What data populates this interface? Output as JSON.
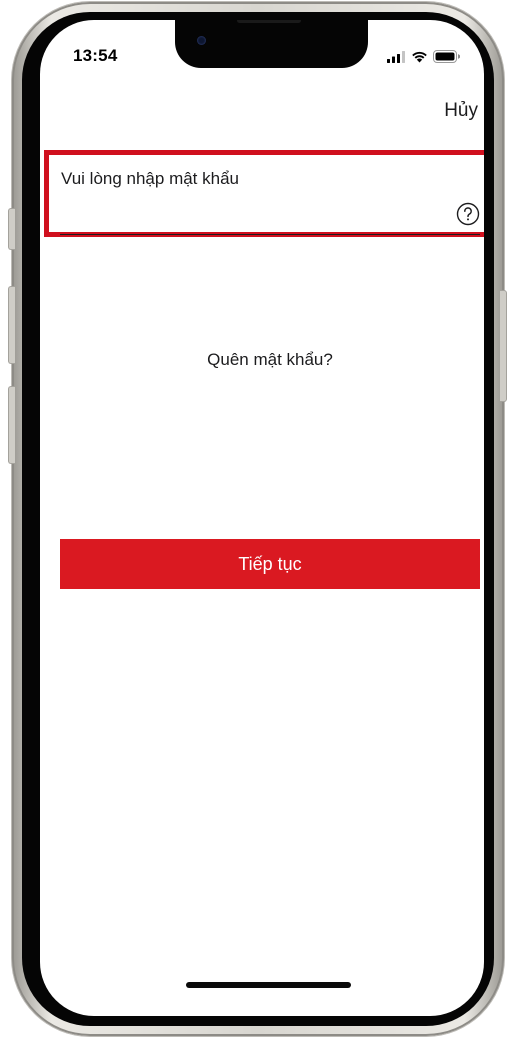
{
  "status_bar": {
    "time": "13:54",
    "icons": [
      "cellular-signal-icon",
      "wifi-icon",
      "battery-icon"
    ]
  },
  "header": {
    "cancel_label": "Hủy"
  },
  "password_field": {
    "label": "Vui lòng nhập mật khẩu",
    "value": "",
    "help_icon": "question-circle-icon"
  },
  "forgot_password_label": "Quên mật khẩu?",
  "continue_button_label": "Tiếp tục",
  "colors": {
    "accent": "#da1921",
    "highlight": "#d0101e",
    "text": "#1c1c1e"
  }
}
